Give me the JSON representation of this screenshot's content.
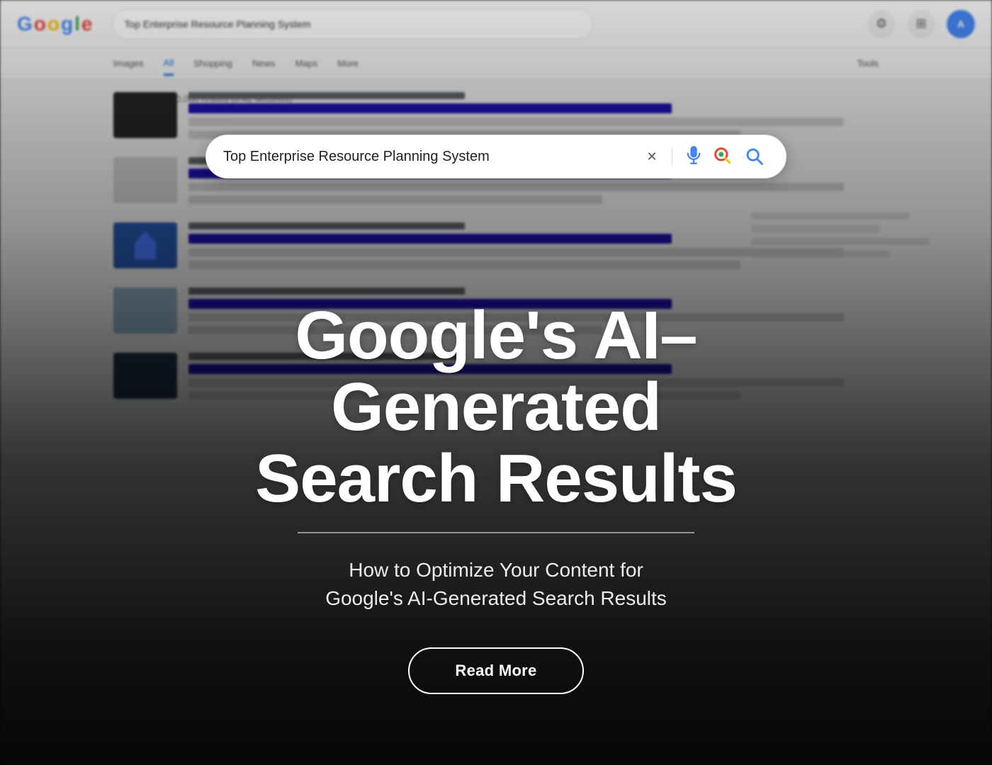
{
  "page": {
    "title": "Google's AI-Generated Search Results"
  },
  "google_bg": {
    "logo": {
      "letters": [
        {
          "char": "G",
          "color": "blue"
        },
        {
          "char": "o",
          "color": "red"
        },
        {
          "char": "o",
          "color": "yellow"
        },
        {
          "char": "g",
          "color": "blue"
        },
        {
          "char": "l",
          "color": "green"
        },
        {
          "char": "e",
          "color": "red"
        }
      ]
    },
    "tabs": [
      "All",
      "Images",
      "Shopping",
      "News",
      "Maps",
      "More",
      "Tools"
    ],
    "active_tab": "All",
    "tools_label": "Tools"
  },
  "search_bar": {
    "query": "Top Enterprise Resource Planning System",
    "clear_icon": "✕",
    "mic_icon": "mic",
    "lens_icon": "lens",
    "search_icon": "search"
  },
  "hero": {
    "main_title_line1": "Google's AI–",
    "main_title_line2": "Generated",
    "main_title_line3": "Search Results",
    "subtitle_line1": "How to Optimize Your Content for",
    "subtitle_line2": "Google's AI-Generated Search Results",
    "read_more_label": "Read More"
  }
}
